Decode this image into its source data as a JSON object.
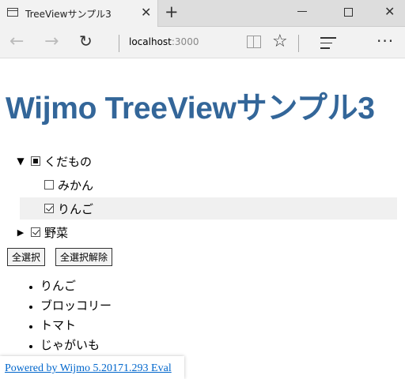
{
  "browser": {
    "tab_title": "TreeViewサンプル3",
    "tab_close": "✕",
    "new_tab": "+",
    "window_close": "✕",
    "url_host": "localhost",
    "url_port": ":3000",
    "more": "···"
  },
  "page": {
    "title": "Wijmo TreeViewサンプル3",
    "tree": {
      "fruits": {
        "label": "くだもの",
        "state": "indeterminate",
        "expanded": true
      },
      "mikan": {
        "label": "みかん",
        "checked": false
      },
      "ringo": {
        "label": "りんご",
        "checked": true,
        "selected": true
      },
      "vegetables": {
        "label": "野菜",
        "checked": true,
        "expanded": false
      }
    },
    "buttons": {
      "select_all": "全選択",
      "deselect_all": "全選択解除"
    },
    "checked_items": [
      "りんご",
      "ブロッコリー",
      "トマト",
      "じゃがいも"
    ],
    "footer_link": "Powered by Wijmo 5.20171.293 Eval"
  }
}
